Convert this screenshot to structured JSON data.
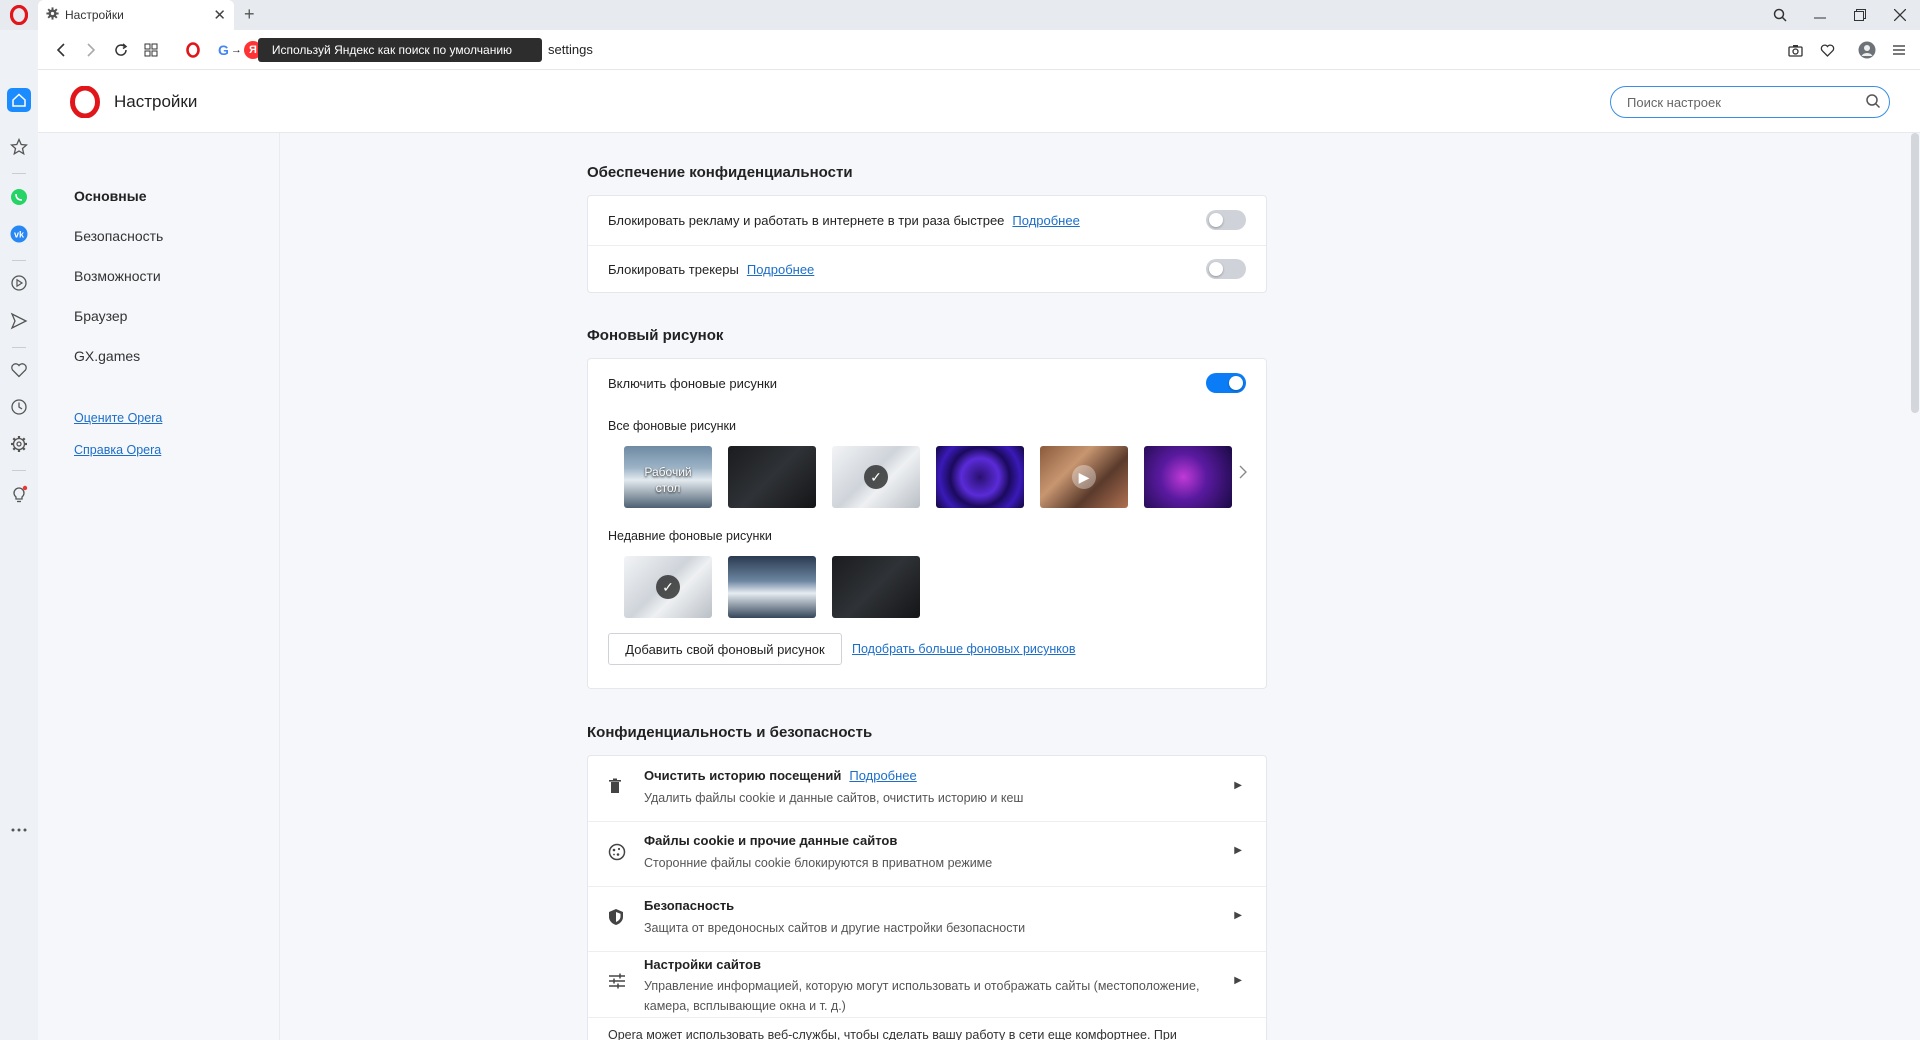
{
  "tab": {
    "title": "Настройки",
    "close": "✕"
  },
  "newtab": "+",
  "address": {
    "yandex_letter": "Я",
    "yandex_tip": "Используй Яндекс как поиск по умолчанию",
    "url": "settings"
  },
  "header": {
    "title": "Настройки",
    "search_placeholder": "Поиск настроек"
  },
  "nav": {
    "items": [
      "Основные",
      "Безопасность",
      "Возможности",
      "Браузер",
      "GX.games"
    ],
    "links": [
      "Оцените Opera",
      "Справка Opera"
    ]
  },
  "privacy": {
    "title": "Обеспечение конфиденциальности",
    "rows": [
      {
        "text": "Блокировать рекламу и работать в интернете в три раза быстрее",
        "link": "Подробнее",
        "on": false
      },
      {
        "text": "Блокировать трекеры",
        "link": "Подробнее",
        "on": false
      }
    ]
  },
  "wallpaper": {
    "title": "Фоновый рисунок",
    "enable_label": "Включить фоновые рисунки",
    "enabled": true,
    "all_label": "Все фоновые рисунки",
    "desktop_label_1": "Рабочий",
    "desktop_label_2": "стол",
    "recent_label": "Недавние фоновые рисунки",
    "add_button": "Добавить свой фоновый рисунок",
    "more_link": "Подобрать больше фоновых рисунков"
  },
  "security": {
    "title": "Конфиденциальность и безопасность",
    "rows": [
      {
        "title": "Очистить историю посещений",
        "link": "Подробнее",
        "sub": "Удалить файлы cookie и данные сайтов, очистить историю и кеш",
        "icon": "trash-icon"
      },
      {
        "title": "Файлы cookie и прочие данные сайтов",
        "link": "",
        "sub": "Сторонние файлы cookie блокируются в приватном режиме",
        "icon": "cookie-icon"
      },
      {
        "title": "Безопасность",
        "link": "",
        "sub": "Защита от вредоносных сайтов и другие настройки безопасности",
        "icon": "shield-icon"
      },
      {
        "title": "Настройки сайтов",
        "link": "",
        "sub": "Управление информацией, которую могут использовать и отображать сайты (местоположение, камера, всплывающие окна и т. д.)",
        "icon": "sliders-icon"
      }
    ],
    "footer_text": "Opera может использовать веб-службы, чтобы сделать вашу работу в сети еще комфортнее. При"
  },
  "colors": {
    "accent": "#0a7cf5",
    "link": "#1c6ec9",
    "opera_red": "#e0161b"
  }
}
